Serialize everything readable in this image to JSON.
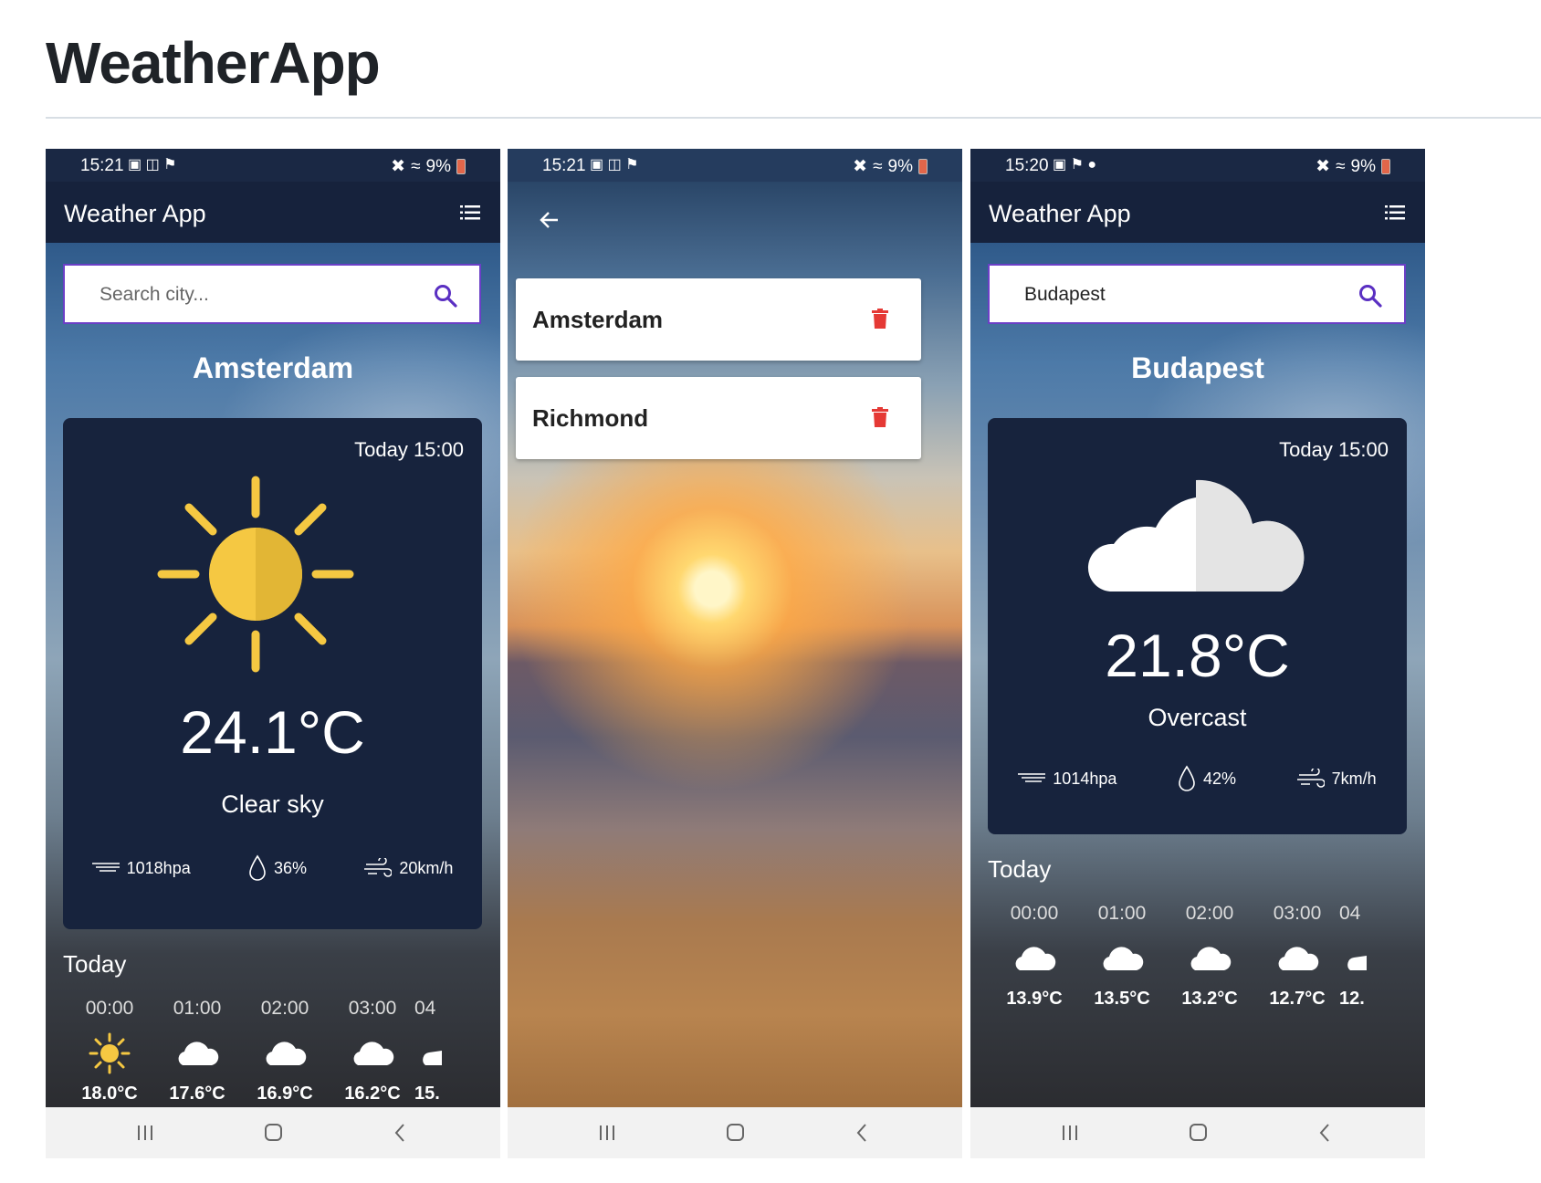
{
  "page": {
    "title": "WeatherApp"
  },
  "screens": [
    {
      "status": {
        "time": "15:21",
        "battery": "9%"
      },
      "appbar": {
        "title": "Weather App"
      },
      "search": {
        "value": "",
        "placeholder": "Search city..."
      },
      "city": "Amsterdam",
      "card": {
        "date": "Today 15:00",
        "icon": "sun-icon",
        "temperature": "24.1°C",
        "description": "Clear sky",
        "pressure": "1018hpa",
        "humidity": "36%",
        "wind": "20km/h"
      },
      "today_label": "Today",
      "hourly": [
        {
          "time": "00:00",
          "icon": "sun-icon",
          "temp": "18.0°C"
        },
        {
          "time": "01:00",
          "icon": "cloud-icon",
          "temp": "17.6°C"
        },
        {
          "time": "02:00",
          "icon": "cloud-icon",
          "temp": "16.9°C"
        },
        {
          "time": "03:00",
          "icon": "cloud-icon",
          "temp": "16.2°C"
        },
        {
          "time": "04",
          "icon": "cloud-icon",
          "temp": "15."
        }
      ]
    },
    {
      "status": {
        "time": "15:21",
        "battery": "9%"
      },
      "saved_cities": [
        {
          "name": "Amsterdam"
        },
        {
          "name": "Richmond"
        }
      ]
    },
    {
      "status": {
        "time": "15:20",
        "battery": "9%"
      },
      "appbar": {
        "title": "Weather App"
      },
      "search": {
        "value": "Budapest",
        "placeholder": "Search city..."
      },
      "city": "Budapest",
      "card": {
        "date": "Today 15:00",
        "icon": "cloud-icon",
        "temperature": "21.8°C",
        "description": "Overcast",
        "pressure": "1014hpa",
        "humidity": "42%",
        "wind": "7km/h"
      },
      "today_label": "Today",
      "hourly": [
        {
          "time": "00:00",
          "icon": "cloud-icon",
          "temp": "13.9°C"
        },
        {
          "time": "01:00",
          "icon": "cloud-icon",
          "temp": "13.5°C"
        },
        {
          "time": "02:00",
          "icon": "cloud-icon",
          "temp": "13.2°C"
        },
        {
          "time": "03:00",
          "icon": "cloud-icon",
          "temp": "12.7°C"
        },
        {
          "time": "04",
          "icon": "cloud-icon",
          "temp": "12."
        }
      ]
    }
  ],
  "colors": {
    "appbar": "#16223c",
    "card": "#17233d",
    "accent": "#6b3fc6",
    "sun": "#f5c842",
    "trash": "#e53935"
  }
}
